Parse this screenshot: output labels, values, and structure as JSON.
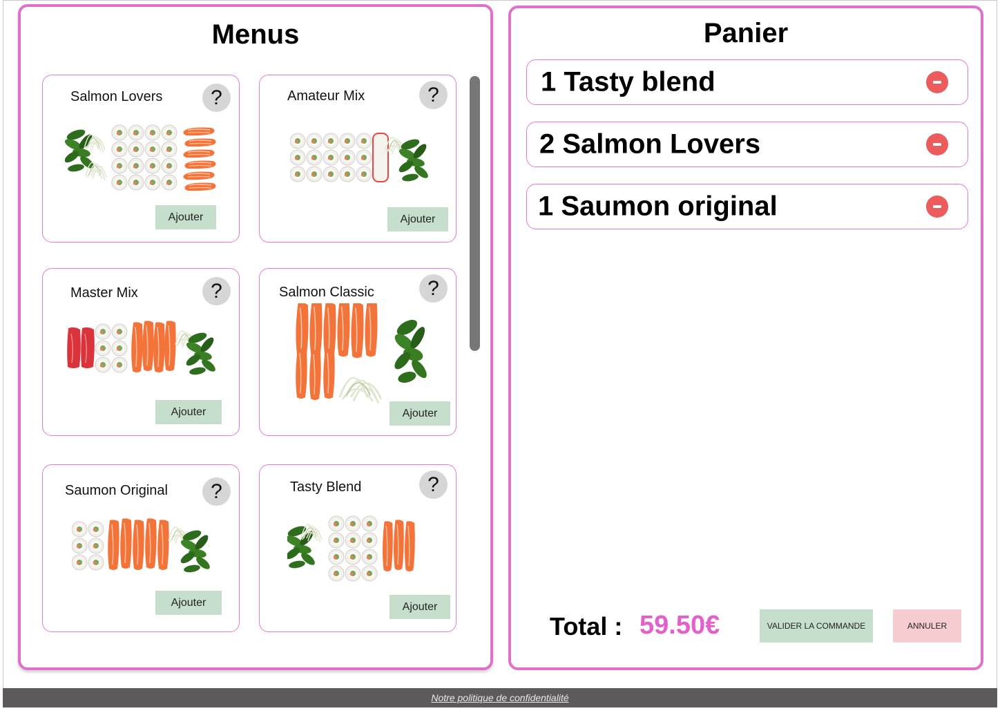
{
  "menus": {
    "title": "Menus",
    "help_symbol": "?",
    "items": [
      {
        "name": "Salmon Lovers",
        "add_label": "Ajouter"
      },
      {
        "name": "Amateur Mix",
        "add_label": "Ajouter"
      },
      {
        "name": "Master Mix",
        "add_label": "Ajouter"
      },
      {
        "name": "Salmon Classic",
        "add_label": "Ajouter"
      },
      {
        "name": "Saumon Original",
        "add_label": "Ajouter"
      },
      {
        "name": "Tasty Blend",
        "add_label": "Ajouter"
      }
    ]
  },
  "cart": {
    "title": "Panier",
    "items": [
      {
        "label": "1 Tasty blend"
      },
      {
        "label": "2 Salmon Lovers"
      },
      {
        "label": "1 Saumon original"
      }
    ],
    "total_label": "Total :",
    "total_value": "59.50€",
    "validate_label": "VALIDER LA COMMANDE",
    "cancel_label": "ANNULER"
  },
  "footer": {
    "privacy_link": "Notre politique de confidentialité"
  },
  "colors": {
    "panel_border": "#e070c8",
    "add_button": "#c6dfcd",
    "cancel_button": "#f8cdd1",
    "remove_button": "#ec5c5c",
    "total_value": "#e35fc9",
    "footer_bg": "#5e5a5b"
  }
}
